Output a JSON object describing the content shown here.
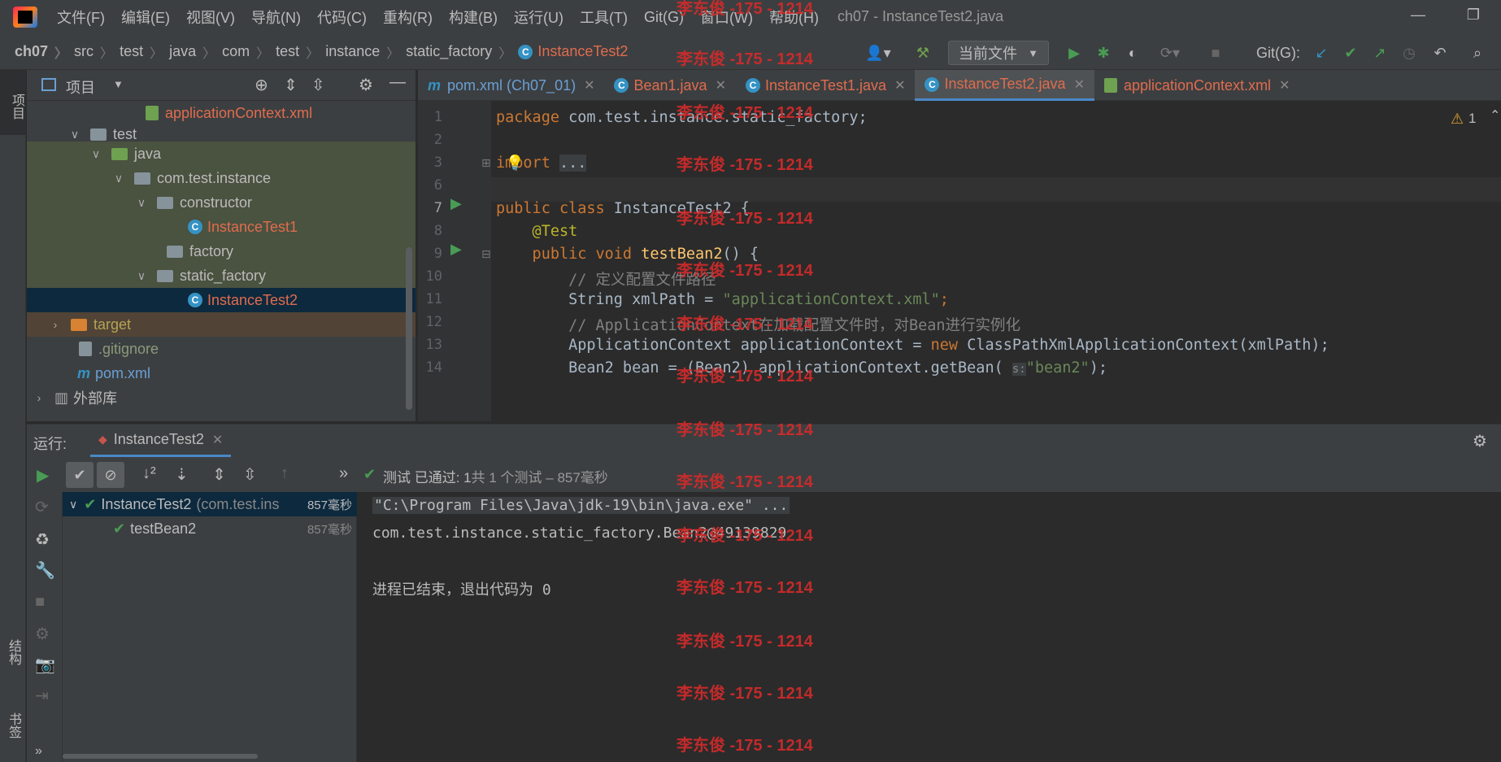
{
  "menubar": {
    "items": [
      "文件(F)",
      "编辑(E)",
      "视图(V)",
      "导航(N)",
      "代码(C)",
      "重构(R)",
      "构建(B)",
      "运行(U)",
      "工具(T)",
      "Git(G)",
      "窗口(W)",
      "帮助(H)"
    ],
    "title": "ch07 - InstanceTest2.java"
  },
  "breadcrumb": [
    "ch07",
    "src",
    "test",
    "java",
    "com",
    "test",
    "instance",
    "static_factory",
    "InstanceTest2"
  ],
  "toolbar": {
    "run_config": "当前文件",
    "git_label": "Git(G):"
  },
  "sidebar": {
    "project_tab": "项目",
    "structure_tab": "结构",
    "bookmarks_tab": "书签"
  },
  "project": {
    "title": "项目"
  },
  "tree": [
    {
      "label": "applicationContext.xml"
    },
    {
      "label": "test"
    },
    {
      "label": "java"
    },
    {
      "label": "com.test.instance"
    },
    {
      "label": "constructor"
    },
    {
      "label": "InstanceTest1"
    },
    {
      "label": "factory"
    },
    {
      "label": "static_factory"
    },
    {
      "label": "InstanceTest2"
    },
    {
      "label": "target"
    },
    {
      "label": ".gitignore"
    },
    {
      "label": "pom.xml"
    },
    {
      "label": "外部库"
    }
  ],
  "tabs": [
    {
      "label": "pom.xml (Ch07_01)"
    },
    {
      "label": "Bean1.java"
    },
    {
      "label": "InstanceTest1.java"
    },
    {
      "label": "InstanceTest2.java"
    },
    {
      "label": "applicationContext.xml"
    }
  ],
  "editor": {
    "warning_count": "1",
    "line_numbers": [
      "1",
      "2",
      "3",
      "6",
      "7",
      "8",
      "9",
      "10",
      "11",
      "12",
      "13",
      "14"
    ],
    "code": {
      "l1a": "package ",
      "l1b": "com.test.instance.static_factory;",
      "l3a": "import ",
      "l3b": "...",
      "l7a": "public class ",
      "l7b": "InstanceTest2 {",
      "l8": "    @Test",
      "l9a": "    public void ",
      "l9b": "testBean2",
      "l9c": "() {",
      "l10": "        // 定义配置文件路径",
      "l11a": "        String xmlPath = ",
      "l11b": "\"applicationContext.xml\"",
      "l11c": ";",
      "l12": "        // ApplicationContext在加载配置文件时，对Bean进行实例化",
      "l13a": "        ApplicationContext applicationContext = ",
      "l13b": "new ",
      "l13c": "ClassPathXmlApplicationContext(xmlPath);",
      "l14a": "        Bean2 bean = (Bean2) applicationContext.getBean( ",
      "l14hint": "s:",
      "l14b": "\"bean2\"",
      "l14c": ");"
    }
  },
  "run": {
    "label": "运行:",
    "tab": "InstanceTest2",
    "status_prefix": "测试 已通过: ",
    "status_count": "1",
    "status_suffix": "共 1 个测试 – 857毫秒"
  },
  "results": [
    {
      "name": "InstanceTest2",
      "pkg": "(com.test.ins",
      "time": "857毫秒"
    },
    {
      "name": "testBean2",
      "time": "857毫秒"
    }
  ],
  "console": {
    "l1": "\"C:\\Program Files\\Java\\jdk-19\\bin\\java.exe\" ...",
    "l2": "com.test.instance.static_factory.Bean2@49139829",
    "l3": "进程已结束，退出代码为 0"
  },
  "watermark": "李东俊 -175 - 1214"
}
